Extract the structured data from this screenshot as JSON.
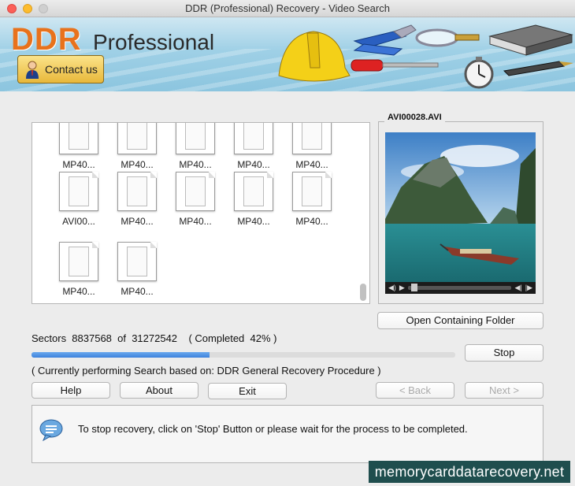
{
  "window": {
    "title": "DDR (Professional) Recovery - Video Search"
  },
  "banner": {
    "logo_ddr": "DDR",
    "logo_professional": "Professional",
    "contact_label": "Contact us",
    "tools_icons": [
      "hard-hat-icon",
      "pliers-icon",
      "screwdriver-icon",
      "magnifier-icon",
      "stopwatch-icon",
      "book-icon",
      "pen-icon"
    ]
  },
  "files": [
    {
      "name": "MP40..."
    },
    {
      "name": "MP40..."
    },
    {
      "name": "MP40..."
    },
    {
      "name": "MP40..."
    },
    {
      "name": "MP40..."
    },
    {
      "name": "AVI00..."
    },
    {
      "name": "MP40..."
    },
    {
      "name": "MP40..."
    },
    {
      "name": "MP40..."
    },
    {
      "name": "MP40..."
    },
    {
      "name": "MP40..."
    },
    {
      "name": "MP40..."
    }
  ],
  "preview": {
    "title": "AVI00028.AVI",
    "open_folder_label": "Open Containing Folder"
  },
  "progress": {
    "sectors_text": "Sectors  8837568  of  31272542    ( Completed  42% )",
    "percent": 42,
    "stop_label": "Stop",
    "procedure_text": "( Currently performing Search based on: DDR General Recovery Procedure )"
  },
  "buttons": {
    "help": "Help",
    "about": "About",
    "exit": "Exit",
    "back": "< Back",
    "next": "Next >"
  },
  "message": {
    "text": "To stop recovery, click on 'Stop' Button or please wait for the process to be completed."
  },
  "watermark": "memorycarddatarecovery.net",
  "colors": {
    "logo_orange": "#e8721c",
    "progress_blue": "#3d82dc",
    "watermark_bg": "#1f4e4e"
  }
}
